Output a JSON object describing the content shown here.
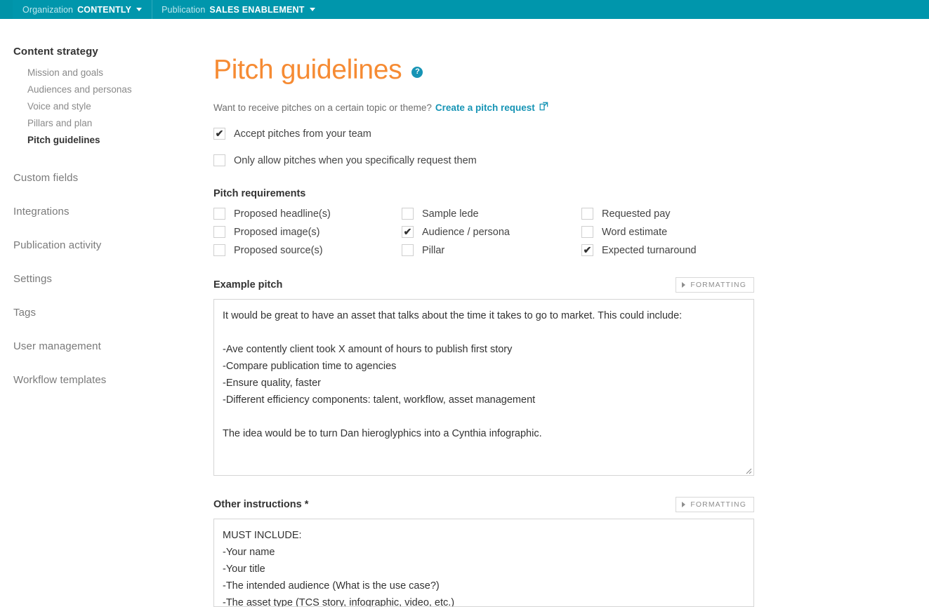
{
  "topbar": {
    "org_label": "Organization",
    "org_value": "CONTENTLY",
    "pub_label": "Publication",
    "pub_value": "SALES ENABLEMENT",
    "bg_color": "#0096ac",
    "label_color": "#bfe7ee"
  },
  "sidebar": {
    "heading": "Content strategy",
    "sub_items": [
      {
        "label": "Mission and goals",
        "active": false
      },
      {
        "label": "Audiences and personas",
        "active": false
      },
      {
        "label": "Voice and style",
        "active": false
      },
      {
        "label": "Pillars and plan",
        "active": false
      },
      {
        "label": "Pitch guidelines",
        "active": true
      }
    ],
    "items": [
      {
        "label": "Custom fields"
      },
      {
        "label": "Integrations"
      },
      {
        "label": "Publication activity"
      },
      {
        "label": "Settings"
      },
      {
        "label": "Tags"
      },
      {
        "label": "User management"
      },
      {
        "label": "Workflow templates"
      }
    ]
  },
  "main": {
    "title": "Pitch guidelines",
    "title_color": "#f68b33",
    "help_icon_glyph": "?",
    "subline_text": "Want to receive pitches on a certain topic or theme?",
    "subline_link": "Create a pitch request",
    "link_color": "#1694b5",
    "toggles": [
      {
        "label": "Accept pitches from your team",
        "checked": true
      },
      {
        "label": "Only allow pitches when you specifically request them",
        "checked": false
      }
    ],
    "requirements_title": "Pitch requirements",
    "requirements": [
      {
        "label": "Proposed headline(s)",
        "checked": false
      },
      {
        "label": "Sample lede",
        "checked": false
      },
      {
        "label": "Requested pay",
        "checked": false
      },
      {
        "label": "Proposed image(s)",
        "checked": false
      },
      {
        "label": "Audience / persona",
        "checked": true
      },
      {
        "label": "Word estimate",
        "checked": false
      },
      {
        "label": "Proposed source(s)",
        "checked": false
      },
      {
        "label": "Pillar",
        "checked": false
      },
      {
        "label": "Expected turnaround",
        "checked": true
      }
    ],
    "example_pitch": {
      "label": "Example pitch",
      "formatting_button": "FORMATTING",
      "value": "It would be great to have an asset that talks about the time it takes to go to market. This could include:\n\n-Ave contently client took X amount of hours to publish first story\n-Compare publication time to agencies\n-Ensure quality, faster\n-Different efficiency components: talent, workflow, asset management\n\nThe idea would be to turn Dan hieroglyphics into a Cynthia infographic."
    },
    "other_instructions": {
      "label": "Other instructions",
      "required_marker": "*",
      "formatting_button": "FORMATTING",
      "value": "MUST INCLUDE:\n-Your name\n-Your title\n-The intended audience (What is the use case?)\n-The asset type (TCS story, infographic, video, etc.)"
    },
    "checkmark_glyph": "✔"
  }
}
